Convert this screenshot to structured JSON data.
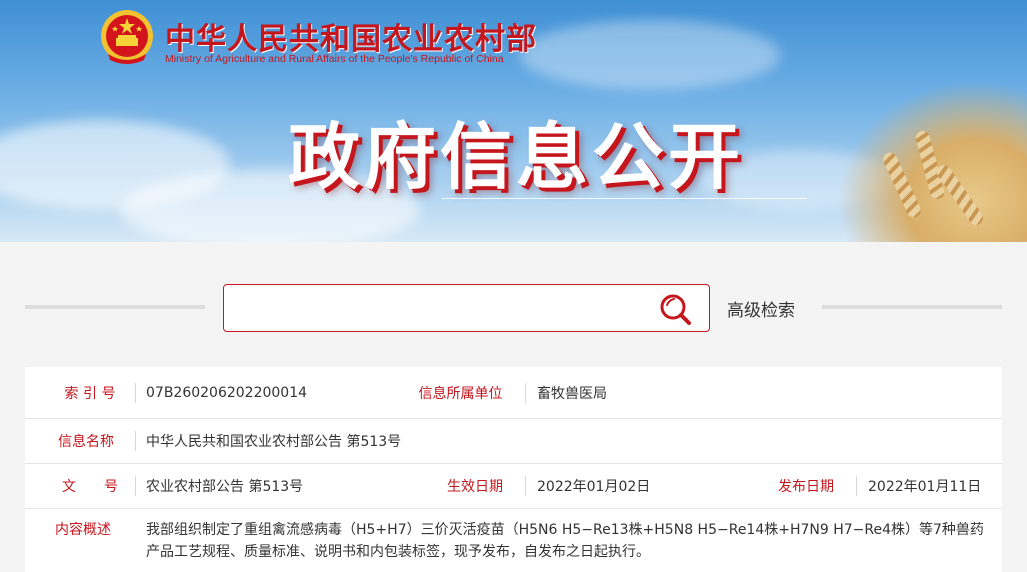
{
  "header": {
    "org_name_cn": "中华人民共和国农业农村部",
    "org_name_en": "Ministry of Agriculture and Rural Affairs of the People's Republic of China",
    "section_title": "政府信息公开"
  },
  "search": {
    "input_value": "",
    "placeholder": "",
    "advanced_label": "高级检索"
  },
  "info": {
    "index_label": "索 引 号",
    "index_value": "07B260206202200014",
    "unit_label": "信息所属单位",
    "unit_value": "畜牧兽医局",
    "name_label": "信息名称",
    "name_value": "中华人民共和国农业农村部公告 第513号",
    "doc_label": "文　　号",
    "doc_value": "农业农村部公告 第513号",
    "effective_label": "生效日期",
    "effective_value": "2022年01月02日",
    "publish_label": "发布日期",
    "publish_value": "2022年01月11日",
    "summary_label": "内容概述",
    "summary_value": "我部组织制定了重组禽流感病毒（H5+H7）三价灭活疫苗（H5N6 H5−Re13株+H5N8 H5−Re14株+H7N9 H7−Re4株）等7种兽药产品工艺规程、质量标准、说明书和内包装标签，现予发布，自发布之日起执行。"
  },
  "colors": {
    "brand_red": "#c4161c",
    "sky_blue": "#6fb0e6",
    "text": "#333333"
  },
  "icons": {
    "emblem": "national-emblem-icon",
    "search": "search-icon"
  }
}
